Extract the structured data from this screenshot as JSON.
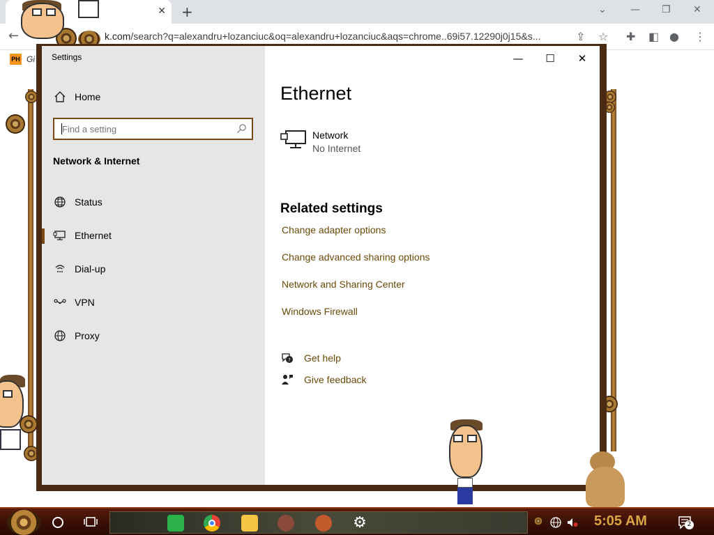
{
  "browser": {
    "tab_close": "✕",
    "new_tab": "+",
    "url_prefix": "k.com",
    "url": "/search?q=alexandru+lozanciuc&oq=alexandru+lozanciuc&aqs=chrome..69i57.12290j0j15&s...",
    "bookmark_badge": "PH",
    "bookmark_label": "Gi"
  },
  "settings": {
    "window_title": "Settings",
    "home_label": "Home",
    "search_placeholder": "Find a setting",
    "category_heading": "Network & Internet",
    "nav_items": [
      {
        "label": "Status",
        "icon": "globe-status-icon",
        "selected": false
      },
      {
        "label": "Ethernet",
        "icon": "ethernet-icon",
        "selected": true
      },
      {
        "label": "Dial-up",
        "icon": "dialup-icon",
        "selected": false
      },
      {
        "label": "VPN",
        "icon": "vpn-icon",
        "selected": false
      },
      {
        "label": "Proxy",
        "icon": "globe-icon",
        "selected": false
      }
    ],
    "page_title": "Ethernet",
    "network": {
      "name": "Network",
      "status": "No Internet"
    },
    "related_heading": "Related settings",
    "related_links": [
      "Change adapter options",
      "Change advanced sharing options",
      "Network and Sharing Center",
      "Windows Firewall"
    ],
    "help": {
      "get_help": "Get help",
      "give_feedback": "Give feedback"
    },
    "accent_color": "#7a4a16",
    "link_color": "#6b4a08"
  },
  "taskbar": {
    "clock": "5:05 AM",
    "notification_count": "2",
    "apps": [
      "spotify-icon",
      "chrome-icon",
      "file-explorer-icon",
      "photo-app-icon",
      "squirrel-app-icon",
      "settings-gear-icon"
    ]
  }
}
